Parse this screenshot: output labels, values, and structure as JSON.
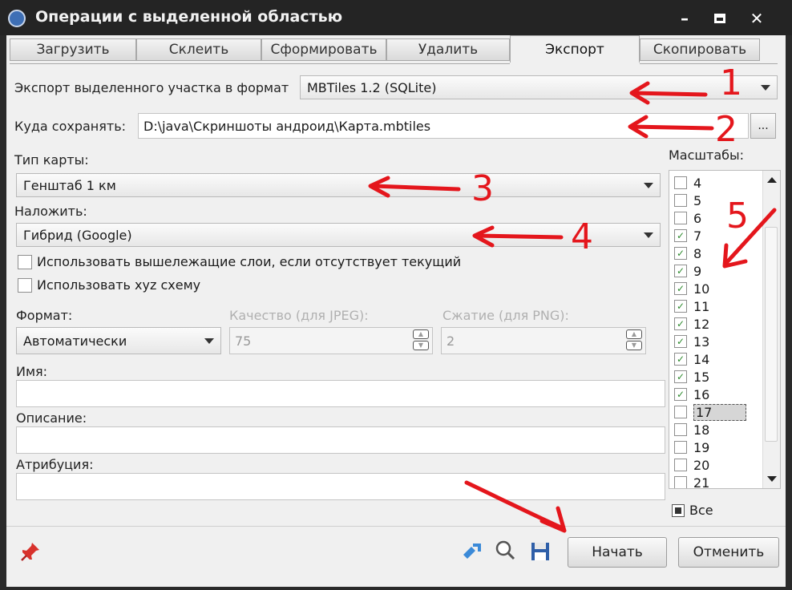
{
  "window": {
    "title": "Операции с выделенной областью",
    "minimize_glyph": "–",
    "close_glyph": "✕"
  },
  "tabs": [
    {
      "label": "Загрузить",
      "active": false
    },
    {
      "label": "Склеить",
      "active": false
    },
    {
      "label": "Сформировать",
      "active": false
    },
    {
      "label": "Удалить",
      "active": false
    },
    {
      "label": "Экспорт",
      "active": true
    },
    {
      "label": "Скопировать",
      "active": false
    }
  ],
  "export": {
    "format_label": "Экспорт выделенного участка в формат",
    "format_value": "MBTiles 1.2 (SQLite)",
    "save_to_label": "Куда сохранять:",
    "save_to_value": "D:\\java\\Скриншоты андроид\\Карта.mbtiles",
    "browse_label": "...",
    "map_type_label": "Тип карты:",
    "map_type_value": "Генштаб 1 км",
    "overlay_label": "Наложить:",
    "overlay_value": "Гибрид (Google)",
    "use_upper_layers_label": "Использовать вышележащие слои, если отсутствует текущий",
    "use_upper_layers_checked": false,
    "use_xyz_label": "Использовать xyz схему",
    "use_xyz_checked": false,
    "format_sub_label": "Формат:",
    "format_sub_value": "Автоматически",
    "quality_label": "Качество (для JPEG):",
    "quality_value": "75",
    "compression_label": "Сжатие (для PNG):",
    "compression_value": "2",
    "name_label": "Имя:",
    "name_value": "",
    "description_label": "Описание:",
    "description_value": "",
    "attribution_label": "Атрибуция:",
    "attribution_value": ""
  },
  "scales": {
    "label": "Масштабы:",
    "items": [
      {
        "label": "4",
        "checked": false
      },
      {
        "label": "5",
        "checked": false
      },
      {
        "label": "6",
        "checked": false
      },
      {
        "label": "7",
        "checked": true
      },
      {
        "label": "8",
        "checked": true
      },
      {
        "label": "9",
        "checked": true
      },
      {
        "label": "10",
        "checked": true
      },
      {
        "label": "11",
        "checked": true
      },
      {
        "label": "12",
        "checked": true
      },
      {
        "label": "13",
        "checked": true
      },
      {
        "label": "14",
        "checked": true
      },
      {
        "label": "15",
        "checked": true
      },
      {
        "label": "16",
        "checked": true
      },
      {
        "label": "17",
        "checked": false
      },
      {
        "label": "18",
        "checked": false
      },
      {
        "label": "19",
        "checked": false
      },
      {
        "label": "20",
        "checked": false
      },
      {
        "label": "21",
        "checked": false
      }
    ],
    "all_label": "Все"
  },
  "footer": {
    "start_label": "Начать",
    "cancel_label": "Отменить"
  },
  "annotations": [
    "1",
    "2",
    "3",
    "4",
    "5"
  ],
  "colors": {
    "annotation_red": "#e4161c",
    "check_green": "#2e8b2e"
  }
}
